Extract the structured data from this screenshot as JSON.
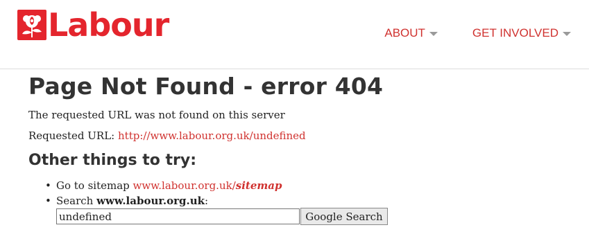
{
  "header": {
    "logo_text": "Labour",
    "nav": [
      {
        "label": "ABOUT"
      },
      {
        "label": "GET INVOLVED"
      }
    ]
  },
  "main": {
    "title": "Page Not Found - error 404",
    "message": "The requested URL was not found on this server",
    "requested_label": "Requested URL: ",
    "requested_url": "http://www.labour.org.uk/undefined",
    "subtitle": "Other things to try:",
    "sitemap_prefix": "Go to sitemap ",
    "sitemap_link_base": "www.labour.org.uk/",
    "sitemap_link_em": "sitemap",
    "search_prefix": "Search ",
    "search_site": "www.labour.org.uk",
    "search_suffix": ":",
    "search_value": "undefined",
    "search_button": "Google Search"
  },
  "colors": {
    "brand_red": "#e4252d",
    "link_red": "#d0322f"
  }
}
